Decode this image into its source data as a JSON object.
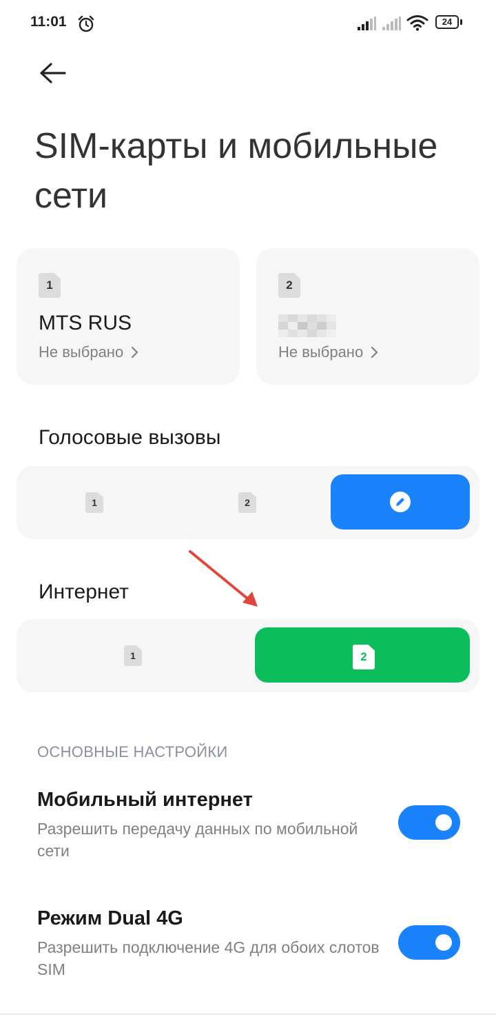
{
  "status_bar": {
    "time": "11:01",
    "battery": "24"
  },
  "header": {
    "title": "SIM-карты и мобильные сети"
  },
  "sim_cards": [
    {
      "slot": "1",
      "carrier": "MTS RUS",
      "status": "Не выбрано"
    },
    {
      "slot": "2",
      "carrier": "",
      "status": "Не выбрано"
    }
  ],
  "voice_calls": {
    "label": "Голосовые вызовы",
    "options": [
      "1",
      "2"
    ],
    "selected": "edit"
  },
  "internet": {
    "label": "Интернет",
    "options": [
      "1",
      "2"
    ],
    "selected": "2"
  },
  "settings": {
    "section_header": "ОСНОВНЫЕ НАСТРОЙКИ",
    "mobile_internet": {
      "title": "Мобильный интернет",
      "description": "Разрешить передачу данных по мобильной сети",
      "enabled": true
    },
    "dual_4g": {
      "title": "Режим Dual 4G",
      "description": "Разрешить подключение 4G для обоих слотов SIM",
      "enabled": true
    }
  },
  "colors": {
    "accent_blue": "#1a82fb",
    "accent_green": "#0bbd5b",
    "card_bg": "#f6f6f6",
    "annotation_arrow": "#e0463a"
  },
  "icons": [
    "alarm-icon",
    "signal-icon",
    "wifi-icon",
    "battery-icon",
    "back-arrow-icon",
    "edit-pencil-icon",
    "chevron-right-icon",
    "sim-chip-icon",
    "annotation-arrow-icon"
  ]
}
